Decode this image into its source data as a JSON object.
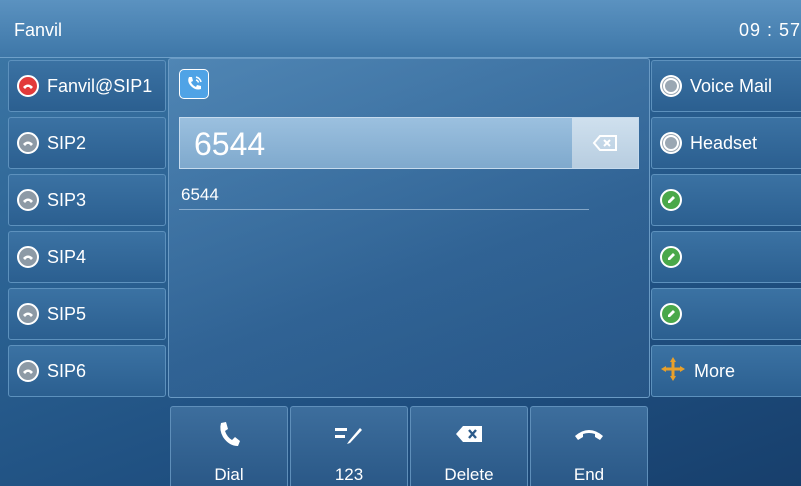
{
  "header": {
    "title": "Fanvil",
    "clock": "09 : 57"
  },
  "lines": [
    {
      "label": "Fanvil@SIP1",
      "status": "active",
      "icon": "red-phone-icon"
    },
    {
      "label": "SIP2",
      "status": "idle",
      "icon": "gray-phone-icon"
    },
    {
      "label": "SIP3",
      "status": "idle",
      "icon": "gray-phone-icon"
    },
    {
      "label": "SIP4",
      "status": "idle",
      "icon": "gray-phone-icon"
    },
    {
      "label": "SIP5",
      "status": "idle",
      "icon": "gray-phone-icon"
    },
    {
      "label": "SIP6",
      "status": "idle",
      "icon": "gray-phone-icon"
    }
  ],
  "dsskeys": [
    {
      "label": "Voice Mail",
      "icon": "ring-icon"
    },
    {
      "label": "Headset",
      "icon": "ring-icon"
    },
    {
      "label": "",
      "icon": "edit-icon"
    },
    {
      "label": "",
      "icon": "edit-icon"
    },
    {
      "label": "",
      "icon": "edit-icon"
    },
    {
      "label": "More",
      "icon": "arrows-icon"
    }
  ],
  "dialer": {
    "number": "6544",
    "suggestion": "6544"
  },
  "softkeys": [
    {
      "label": "Dial",
      "icon": "phone-icon"
    },
    {
      "label": "123",
      "icon": "input-mode-icon"
    },
    {
      "label": "Delete",
      "icon": "delete-icon"
    },
    {
      "label": "End",
      "icon": "hangup-icon"
    }
  ],
  "colors": {
    "active_line": "#e23a3a",
    "idle_line": "#8d9aa6",
    "edit": "#4aa84a",
    "accent": "#4fa3e6"
  }
}
